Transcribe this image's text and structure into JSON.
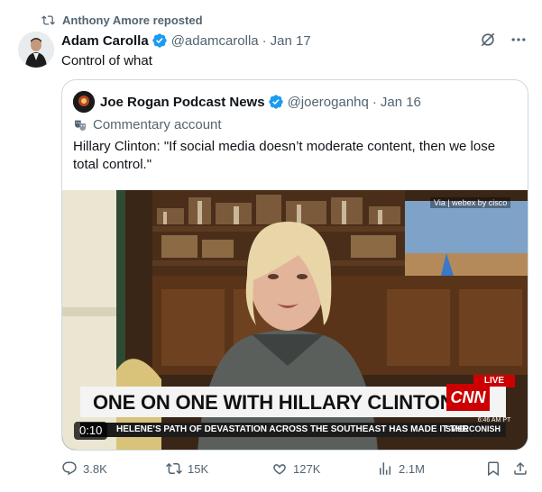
{
  "repost": {
    "text": "Anthony Amore reposted"
  },
  "post": {
    "author_name": "Adam Carolla",
    "handle": "@adamcarolla",
    "separator": "·",
    "date": "Jan 17",
    "text": "Control of what"
  },
  "quote": {
    "author_name": "Joe Rogan Podcast News",
    "handle": "@joeroganhq",
    "separator": "·",
    "date": "Jan 16",
    "commentary_label": "Commentary account",
    "text": "Hillary Clinton: \"If social media doesn’t moderate content, then we lose total control.\"",
    "video": {
      "duration": "0:10",
      "via_label": "Via | webex by cisco",
      "live_label": "LIVE",
      "network": "CNN",
      "lower_third": "ONE ON ONE WITH HILLARY CLINTON",
      "clock": "6:46 AM PT",
      "ticker": "HELENE'S PATH OF DEVASTATION ACROSS THE SOUTHEAST HAS MADE IT THE",
      "show": "SMERCONISH"
    }
  },
  "actions": {
    "replies": "3.8K",
    "reposts": "15K",
    "likes": "127K",
    "views": "2.1M"
  },
  "colors": {
    "verified": "#1d9bf0",
    "text_secondary": "#536471",
    "border": "#cfd9de"
  }
}
